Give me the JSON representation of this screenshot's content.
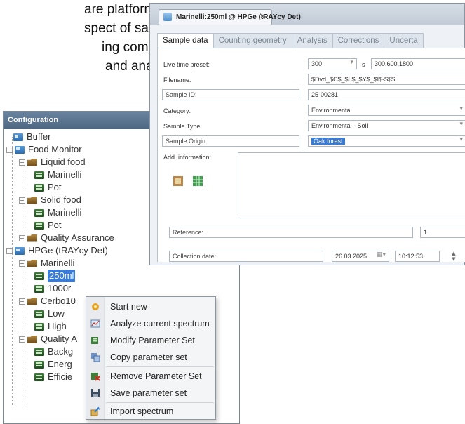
{
  "background_text": {
    "lines": [
      "are platform for",
      "spect of sample",
      "ing complex,",
      "and analytical"
    ]
  },
  "config": {
    "title": "Configuration",
    "tree": [
      {
        "label": "Buffer",
        "icon": "dataset-icon"
      },
      {
        "label": "Food Monitor",
        "icon": "dataset-icon"
      },
      {
        "label": "Liquid food",
        "icon": "folder-icon"
      },
      {
        "label": "Marinelli",
        "icon": "parameter-set-icon"
      },
      {
        "label": "Pot",
        "icon": "parameter-set-icon"
      },
      {
        "label": "Solid food",
        "icon": "folder-icon"
      },
      {
        "label": "Marinelli",
        "icon": "parameter-set-icon"
      },
      {
        "label": "Pot",
        "icon": "parameter-set-icon"
      },
      {
        "label": "Quality Assurance",
        "icon": "folder-icon"
      },
      {
        "label": "HPGe (tRAYcy Det)",
        "icon": "dataset-icon"
      },
      {
        "label": "Marinelli",
        "icon": "folder-icon"
      },
      {
        "label": "250ml",
        "icon": "parameter-set-icon",
        "selected": true
      },
      {
        "label": "1000r",
        "icon": "parameter-set-icon"
      },
      {
        "label": "Cerbo10",
        "icon": "folder-icon"
      },
      {
        "label": "Low",
        "icon": "parameter-set-icon"
      },
      {
        "label": "High",
        "icon": "parameter-set-icon"
      },
      {
        "label": "Quality A",
        "icon": "folder-icon"
      },
      {
        "label": "Backg",
        "icon": "parameter-set-icon"
      },
      {
        "label": "Energ",
        "icon": "parameter-set-icon"
      },
      {
        "label": "Efficie",
        "icon": "parameter-set-icon"
      }
    ]
  },
  "context_menu": {
    "items": [
      {
        "label": "Start new",
        "icon": "start-new-icon"
      },
      {
        "label": "Analyze current spectrum",
        "icon": "analyze-icon"
      },
      {
        "label": "Modify Parameter Set",
        "icon": "modify-icon"
      },
      {
        "label": "Copy parameter set",
        "icon": "copy-icon"
      },
      {
        "label": "Remove Parameter Set",
        "icon": "remove-icon"
      },
      {
        "label": "Save parameter set",
        "icon": "save-icon"
      },
      {
        "label": "Import spectrum",
        "icon": "import-icon"
      }
    ]
  },
  "sample_window": {
    "doc_tab": "Marinelli:250ml @ HPGe (tRAYcy Det)",
    "doc_tab_close": "✕",
    "tabs": [
      "Sample data",
      "Counting geometry",
      "Analysis",
      "Corrections",
      "Uncerta"
    ],
    "fields": {
      "live_time_label": "Live time preset:",
      "live_time_value": "300",
      "live_time_unit": "s",
      "live_time_extra": "300,600,1800",
      "filename_label": "Filename:",
      "filename_value": "$Dvd_$C$_$L$_$Y$_$I$-$$$",
      "sample_id_label": "Sample ID:",
      "sample_id_value": "25-00281",
      "category_label": "Category:",
      "category_value": "Environmental",
      "sample_type_label": "Sample Type:",
      "sample_type_value": "Environmental - Soil",
      "sample_origin_label": "Sample Origin:",
      "sample_origin_value": "Oak forest",
      "add_info_label": "Add. information:",
      "reference_label": "Reference:",
      "reference_value": "1",
      "collection_date_label": "Collection date:",
      "collection_date_value": "26.03.2025",
      "collection_time_value": "10:12:53"
    }
  },
  "colors": {
    "selection": "#3a7bd5",
    "config_header": "#5a7390",
    "window_border": "#8994a0"
  }
}
